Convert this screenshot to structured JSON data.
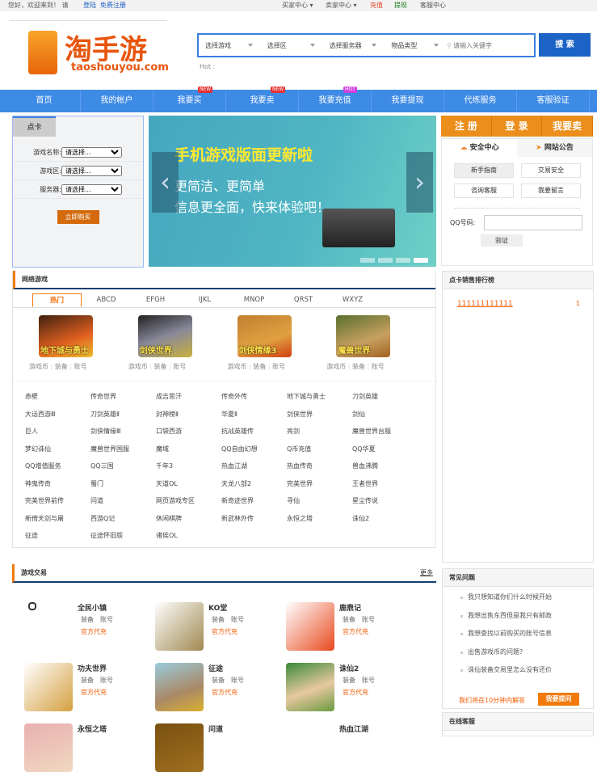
{
  "topbar": {
    "greeting": "您好，欢迎来到！ 请",
    "login": "登陆",
    "register": "免费注册",
    "buyer": "买家中心 ▾",
    "seller": "卖家中心 ▾",
    "recharge": "充值",
    "withdraw": "提现",
    "service": "客服中心"
  },
  "logo": {
    "name": "淘手游",
    "domain": "taoshouyou.com"
  },
  "search": {
    "game": "选择游戏",
    "zone": "选择区",
    "server": "选择服务器",
    "type": "物品类型",
    "placeholder": "请输入关键字",
    "button": "搜 索",
    "hot": "Hot :"
  },
  "nav": [
    {
      "label": "首页"
    },
    {
      "label": "我的帐户"
    },
    {
      "label": "我要买",
      "badge": "NEW"
    },
    {
      "label": "我要卖",
      "badge": "NEW"
    },
    {
      "label": "我要充值",
      "badge": "HOT"
    },
    {
      "label": "我要提现"
    },
    {
      "label": "代练服务"
    },
    {
      "label": "客服验证"
    }
  ],
  "card": {
    "tab": "点卡",
    "game_label": "游戏名称:",
    "zone_label": "游戏区:",
    "server_label": "服务器:",
    "select": "请选择...",
    "buy": "立即购买"
  },
  "banner": {
    "title": "手机游戏版面更新啦",
    "line1": "更简洁、更简单",
    "line2": "信息更全面，快来体验吧！"
  },
  "right": {
    "register": "注 册",
    "login": "登 录",
    "sell": "我要卖",
    "tab1": "安全中心",
    "tab2": "网站公告",
    "buttons": [
      "新手指南",
      "交易安全",
      "咨询客服",
      "我要留言"
    ],
    "qq_label": "QQ号码:",
    "verify": "验证"
  },
  "ranking": {
    "title": "点卡销售排行榜",
    "item": "111111111111",
    "count": "1"
  },
  "netgames": {
    "title": "网络游戏",
    "tabs": [
      "热门",
      "ABCD",
      "EFGH",
      "IJKL",
      "MNOP",
      "QRST",
      "WXYZ"
    ],
    "hot": [
      {
        "name": "地下城与勇士"
      },
      {
        "name": "剑侠世界"
      },
      {
        "name": "剑侠情缘3"
      },
      {
        "name": "魔兽世界"
      }
    ],
    "hot_links": [
      "游戏币",
      "装备",
      "账号"
    ],
    "list": [
      "赤壁",
      "传奇世界",
      "成吉思汗",
      "传奇外传",
      "地下城与勇士",
      "刀剑英雄",
      "大话西游Ⅲ",
      "刀剑英雄Ⅱ",
      "封神榜Ⅱ",
      "华夏Ⅱ",
      "剑侠世界",
      "剑仙",
      "巨人",
      "剑侠情缘Ⅲ",
      "口袋西游",
      "抗战英雄传",
      "亮剑",
      "魔兽世界台服",
      "梦幻诛仙",
      "魔兽世界国服",
      "魔域",
      "QQ自由幻想",
      "Q币充值",
      "QQ华夏",
      "QQ增值服务",
      "QQ三国",
      "千年3",
      "热血江湖",
      "热血传奇",
      "兽血沸腾",
      "神鬼传奇",
      "蜀门",
      "天道OL",
      "天龙八部2",
      "完美世界",
      "王者世界",
      "完美世界前传",
      "问道",
      "网页游戏专区",
      "新奇迹世界",
      "寻仙",
      "星尘传说",
      "新倚天剑与屠",
      "西游Q记",
      "休闲棋牌",
      "新武林外传",
      "永恒之塔",
      "诛仙2",
      "征途",
      "征途怀旧版",
      "诸侯OL"
    ]
  },
  "trade": {
    "title": "游戏交易",
    "more": "更多",
    "equip": "装备",
    "account": "账号",
    "official": "官方代充",
    "items": [
      {
        "name": "全民小镇"
      },
      {
        "name": "KO堂"
      },
      {
        "name": "鹿鼎记"
      },
      {
        "name": "功夫世界"
      },
      {
        "name": "征途"
      },
      {
        "name": "诛仙2"
      },
      {
        "name": "永恒之塔"
      },
      {
        "name": "问道"
      },
      {
        "name": "热血江湖"
      }
    ]
  },
  "faq": {
    "title": "常见问题",
    "items": [
      "我只想知道你们什么时候开始",
      "我想出售东西但是我只有邮政",
      "我想查找以前购买的账号信息",
      "出售游戏币的问题?",
      "诛仙装备交易里怎么没有还价"
    ],
    "note": "我们将在10分钟内解答",
    "ask": "我要提问"
  },
  "online": {
    "title": "在线客服"
  }
}
